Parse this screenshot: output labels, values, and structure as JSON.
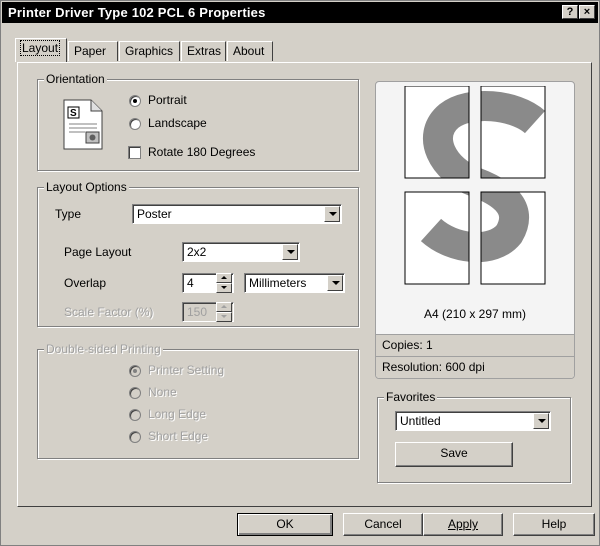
{
  "window": {
    "title": "Printer Driver Type 102 PCL 6 Properties",
    "help_label": "?",
    "close_label": "×"
  },
  "tabs": [
    {
      "label": "Layout"
    },
    {
      "label": "Paper"
    },
    {
      "label": "Graphics"
    },
    {
      "label": "Extras"
    },
    {
      "label": "About"
    }
  ],
  "orientation": {
    "title": "Orientation",
    "portrait": "Portrait",
    "landscape": "Landscape",
    "rotate": "Rotate 180 Degrees",
    "selected": "Portrait",
    "icon_letter": "S"
  },
  "layout_options": {
    "title": "Layout Options",
    "type_label": "Type",
    "type_value": "Poster",
    "page_layout_label": "Page Layout",
    "page_layout_value": "2x2",
    "overlap_label": "Overlap",
    "overlap_value": "4",
    "overlap_unit": "Millimeters",
    "scale_label": "Scale Factor (%)",
    "scale_value": "150"
  },
  "duplex": {
    "title": "Double-sided Printing",
    "options": [
      "Printer Setting",
      "None",
      "Long Edge",
      "Short Edge"
    ],
    "selected": "Printer Setting"
  },
  "preview": {
    "paper": "A4 (210 x 297 mm)",
    "copies": "Copies: 1",
    "resolution": "Resolution: 600 dpi",
    "poster_color": "#8a8a8a"
  },
  "favorites": {
    "title": "Favorites",
    "value": "Untitled",
    "save_label": "Save"
  },
  "buttons": {
    "ok": "OK",
    "cancel": "Cancel",
    "apply": "Apply",
    "help": "Help"
  }
}
